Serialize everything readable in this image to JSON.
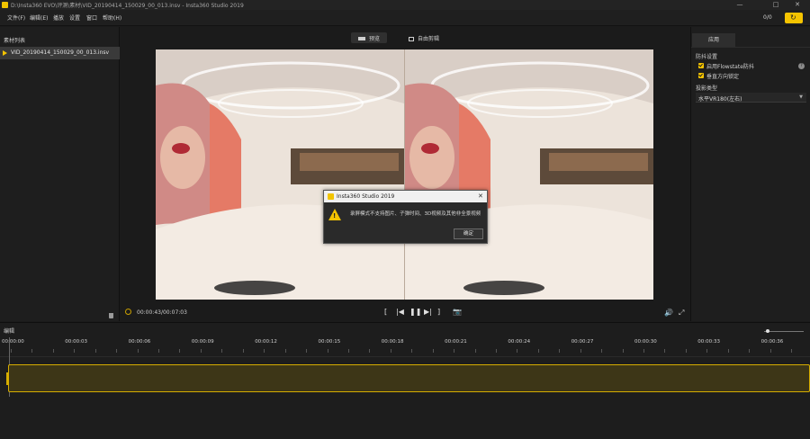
{
  "window": {
    "title": "D:\\Insta360 EVO\\评测\\素材\\VID_20190414_150029_00_013.insv - Insta360 Studio 2019",
    "minimize": "—",
    "maximize": "□",
    "close": "✕"
  },
  "menu": {
    "items": [
      "文件(F)",
      "编辑(E)",
      "播放",
      "设置",
      "窗口",
      "帮助(H)"
    ],
    "page_count": "0/0"
  },
  "left_panel": {
    "header": "素材列表",
    "files": [
      "VID_20190414_150029_00_013.insv"
    ]
  },
  "center": {
    "tabs": [
      "预览",
      "自由剪辑"
    ],
    "active_tab": 0,
    "timecode": "00:00:43/00:07:03",
    "controls": {
      "in_point": "[",
      "prev_frame": "|◀",
      "pause": "❚❚",
      "next_frame": "▶|",
      "out_point": "]",
      "snapshot": "📷",
      "volume": "🔊",
      "fullscreen": "⤢"
    }
  },
  "right_panel": {
    "tab": "应用",
    "stabilization_header": "防抖设置",
    "options": [
      {
        "label": "启用Flowstate防抖",
        "checked": true
      },
      {
        "label": "垂直方向锁定",
        "checked": true
      }
    ],
    "help": "?",
    "projection_header": "投影类型",
    "projection_value": "水平VR180(左右)"
  },
  "dialog": {
    "title": "Insta360 Studio 2019",
    "message": "录屏模式不支持图片、子弹时间、3D视频及其他非全景视频",
    "ok": "确定",
    "close": "✕"
  },
  "timeline": {
    "label": "编辑",
    "ticks": [
      "00:00:00",
      "00:00:03",
      "00:00:06",
      "00:00:09",
      "00:00:12",
      "00:00:15",
      "00:00:18",
      "00:00:21",
      "00:00:24",
      "00:00:27",
      "00:00:30",
      "00:00:33",
      "00:00:36"
    ]
  },
  "colors": {
    "accent": "#f5c400",
    "background": "#1b1b1b",
    "panel": "#1e1e1e",
    "clip_fill": "#3d3617"
  }
}
